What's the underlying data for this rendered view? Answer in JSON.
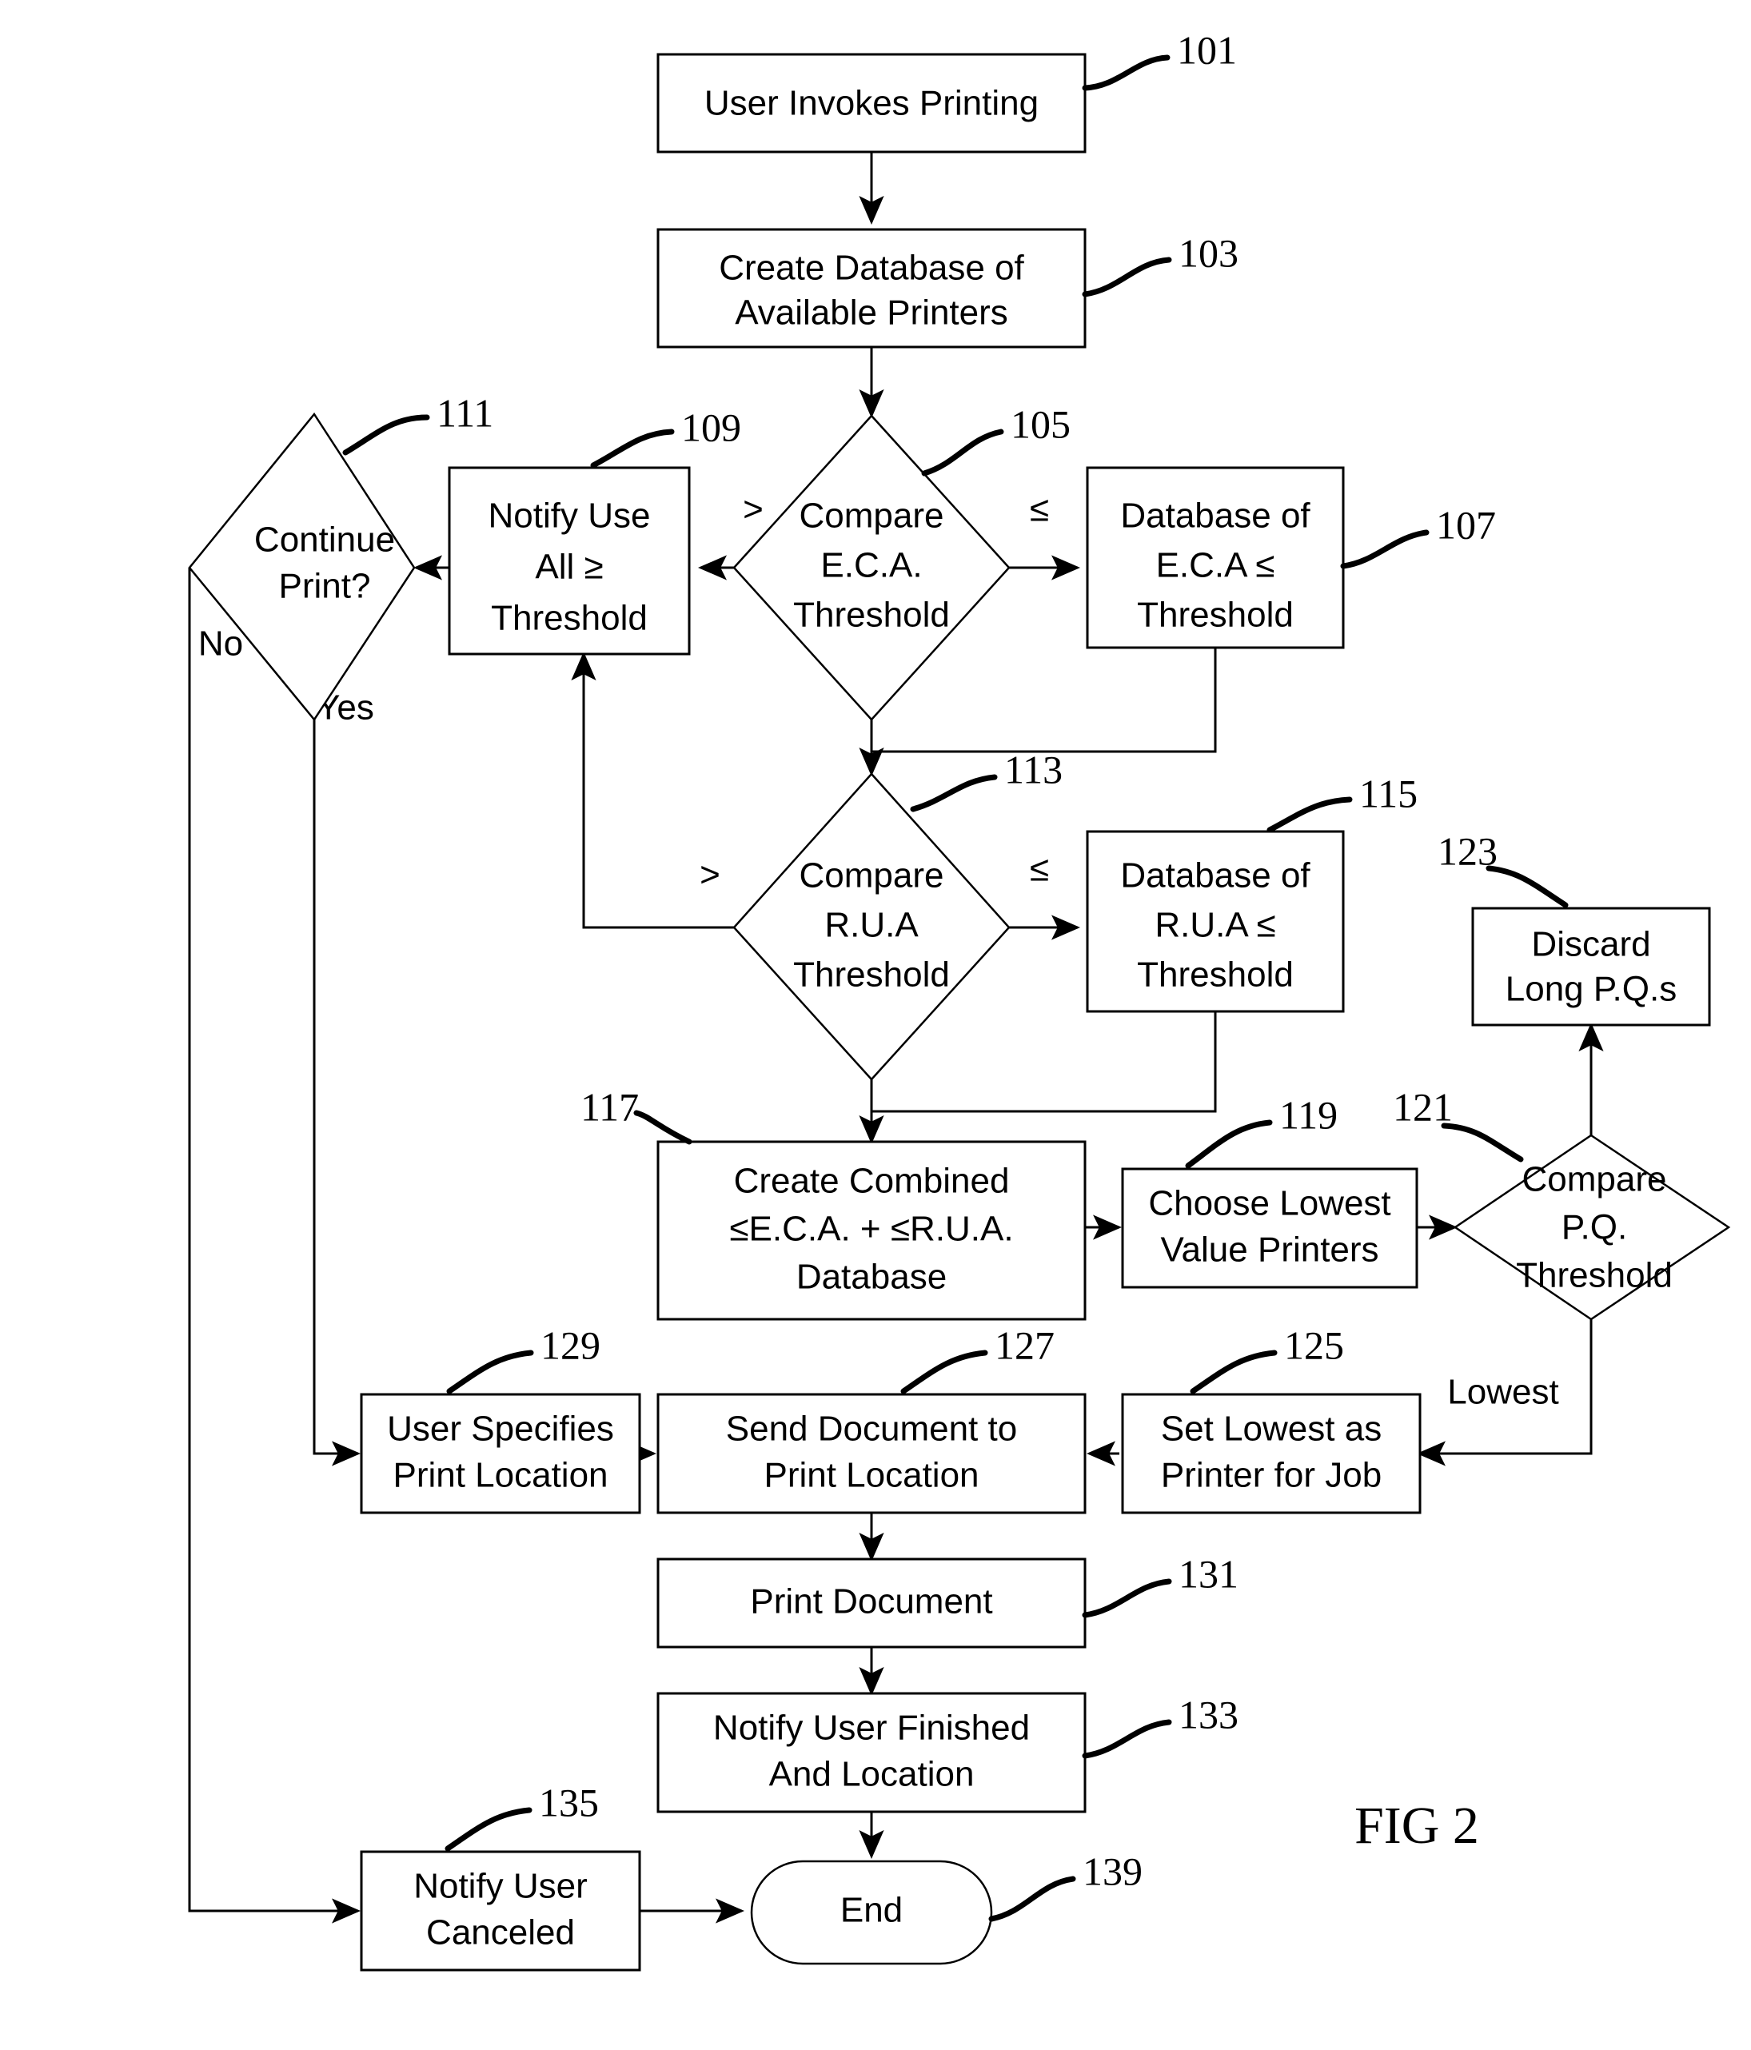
{
  "figure": {
    "label": "FIG 2",
    "title": "Printing workflow flowchart"
  },
  "nodes": [
    {
      "id": "n101",
      "ref": "101",
      "shape": "process",
      "lines": [
        "User Invokes Printing"
      ]
    },
    {
      "id": "n103",
      "ref": "103",
      "shape": "process",
      "lines": [
        "Create Database of",
        "Available Printers"
      ]
    },
    {
      "id": "n105",
      "ref": "105",
      "shape": "decision",
      "lines": [
        "Compare",
        "E.C.A.",
        "Threshold"
      ]
    },
    {
      "id": "n107",
      "ref": "107",
      "shape": "process",
      "lines": [
        "Database of",
        "E.C.A  ≤",
        "Threshold"
      ]
    },
    {
      "id": "n109",
      "ref": "109",
      "shape": "process",
      "lines": [
        "Notify Use",
        "All ≥",
        "Threshold"
      ]
    },
    {
      "id": "n111",
      "ref": "111",
      "shape": "decision",
      "lines": [
        "Continue",
        "Print?"
      ]
    },
    {
      "id": "n113",
      "ref": "113",
      "shape": "decision",
      "lines": [
        "Compare",
        "R.U.A",
        "Threshold"
      ]
    },
    {
      "id": "n115",
      "ref": "115",
      "shape": "process",
      "lines": [
        "Database of",
        "R.U.A  ≤",
        "Threshold"
      ]
    },
    {
      "id": "n117",
      "ref": "117",
      "shape": "process",
      "lines": [
        "Create Combined",
        "≤E.C.A. + ≤R.U.A.",
        "Database"
      ]
    },
    {
      "id": "n119",
      "ref": "119",
      "shape": "process",
      "lines": [
        "Choose Lowest",
        "Value Printers"
      ]
    },
    {
      "id": "n121",
      "ref": "121",
      "shape": "decision",
      "lines": [
        "Compare",
        "P.Q.",
        "Threshold"
      ]
    },
    {
      "id": "n123",
      "ref": "123",
      "shape": "process",
      "lines": [
        "Discard",
        "Long P.Q.s"
      ]
    },
    {
      "id": "n125",
      "ref": "125",
      "shape": "process",
      "lines": [
        "Set Lowest as",
        "Printer for Job"
      ]
    },
    {
      "id": "n127",
      "ref": "127",
      "shape": "process",
      "lines": [
        "Send Document to",
        "Print Location"
      ]
    },
    {
      "id": "n129",
      "ref": "129",
      "shape": "process",
      "lines": [
        "User Specifies",
        "Print Location"
      ]
    },
    {
      "id": "n131",
      "ref": "131",
      "shape": "process",
      "lines": [
        "Print Document"
      ]
    },
    {
      "id": "n133",
      "ref": "133",
      "shape": "process",
      "lines": [
        "Notify User Finished",
        "And Location"
      ]
    },
    {
      "id": "n135",
      "ref": "135",
      "shape": "process",
      "lines": [
        "Notify User",
        "Canceled"
      ]
    },
    {
      "id": "n139",
      "ref": "139",
      "shape": "terminal",
      "lines": [
        "End"
      ]
    }
  ],
  "edge_labels": {
    "eca_greater": ">",
    "eca_lesser": "≤",
    "rua_greater": ">",
    "rua_lesser": "≤",
    "continue_no": "No",
    "continue_yes": "Yes",
    "pq_lowest": "Lowest"
  },
  "colors": {
    "stroke": "#000000",
    "fill": "#ffffff"
  }
}
